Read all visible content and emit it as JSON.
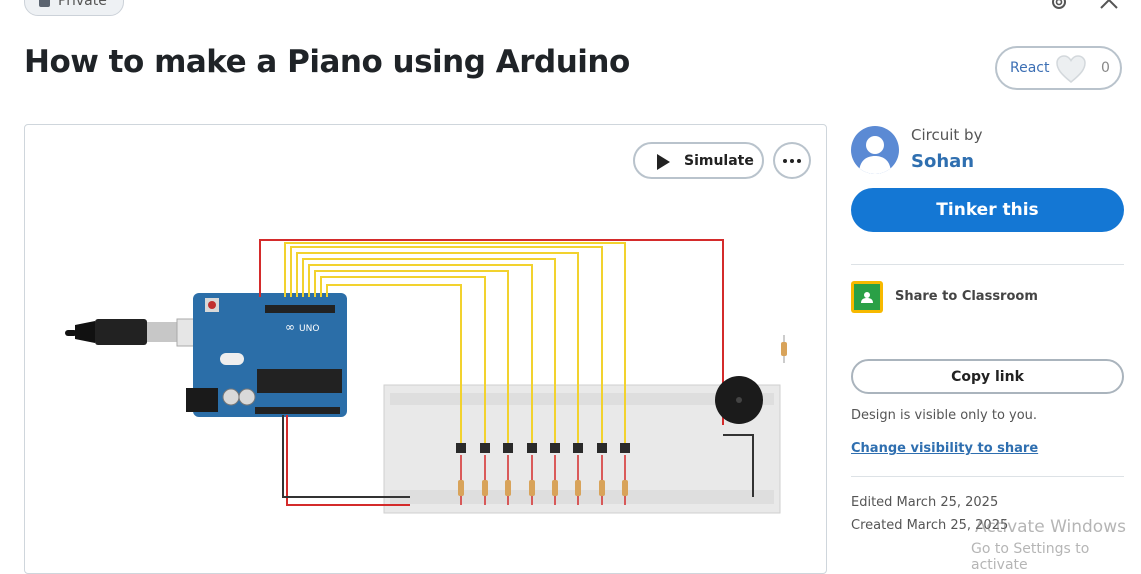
{
  "header": {
    "privacy_label": "Private",
    "title": "How to make a Piano using Arduino",
    "react": {
      "label": "React",
      "count": "0"
    }
  },
  "circuit": {
    "simulate_label": "Simulate"
  },
  "sidebar": {
    "circuit_by": "Circuit by",
    "author": "Sohan",
    "tinker_label": "Tinker this",
    "share_classroom": "Share to Classroom",
    "copy_link": "Copy link",
    "visibility_text": "Design is visible only to you.",
    "visibility_link": "Change visibility to share",
    "edited": "Edited March 25, 2025",
    "created": "Created March 25, 2025"
  },
  "overlay": {
    "activate_title": "Activate Windows",
    "activate_sub": "Go to Settings to activate"
  },
  "colors": {
    "accent": "#1477d4",
    "link": "#2f6fb0",
    "arduino_board": "#2b6ea8",
    "wire_yellow": "#f2d22e",
    "wire_red": "#d42b2b"
  },
  "icons": [
    "lock-icon",
    "gear-icon",
    "close-icon",
    "heart-icon",
    "play-icon",
    "more-icon",
    "user-avatar-icon",
    "google-classroom-icon"
  ]
}
